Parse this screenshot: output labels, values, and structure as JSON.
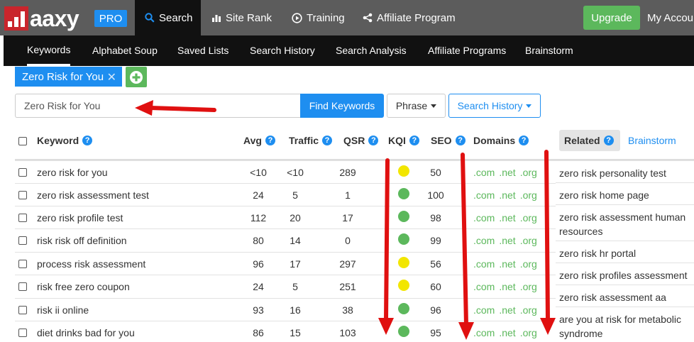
{
  "brand": {
    "logo_text": "aaxy",
    "badge": "PRO"
  },
  "topnav": [
    {
      "label": "Search",
      "icon": "search-icon",
      "active": true
    },
    {
      "label": "Site Rank",
      "icon": "bar-chart-icon"
    },
    {
      "label": "Training",
      "icon": "play-circle-icon"
    },
    {
      "label": "Affiliate Program",
      "icon": "share-icon"
    }
  ],
  "upgrade_label": "Upgrade",
  "account_label": "My Account",
  "subnav": [
    "Keywords",
    "Alphabet Soup",
    "Saved Lists",
    "Search History",
    "Search Analysis",
    "Affiliate Programs",
    "Brainstorm"
  ],
  "keyword_tab": "Zero Risk for You",
  "search": {
    "value": "Zero Risk for You",
    "find_label": "Find Keywords",
    "phrase_label": "Phrase",
    "history_label": "Search History"
  },
  "table": {
    "headers": {
      "keyword": "Keyword",
      "avg": "Avg",
      "traffic": "Traffic",
      "qsr": "QSR",
      "kqi": "KQI",
      "seo": "SEO",
      "domains": "Domains"
    },
    "rows": [
      {
        "keyword": "zero risk for you",
        "avg": "<10",
        "traffic": "<10",
        "qsr": "289",
        "kqi": "yellow",
        "seo": "50"
      },
      {
        "keyword": "zero risk assessment test",
        "avg": "24",
        "traffic": "5",
        "qsr": "1",
        "kqi": "green",
        "seo": "100"
      },
      {
        "keyword": "zero risk profile test",
        "avg": "112",
        "traffic": "20",
        "qsr": "17",
        "kqi": "green",
        "seo": "98"
      },
      {
        "keyword": "risk risk off definition",
        "avg": "80",
        "traffic": "14",
        "qsr": "0",
        "kqi": "green",
        "seo": "99"
      },
      {
        "keyword": "process risk assessment",
        "avg": "96",
        "traffic": "17",
        "qsr": "297",
        "kqi": "yellow",
        "seo": "56"
      },
      {
        "keyword": "risk free zero coupon",
        "avg": "24",
        "traffic": "5",
        "qsr": "251",
        "kqi": "yellow",
        "seo": "60"
      },
      {
        "keyword": "risk ii online",
        "avg": "93",
        "traffic": "16",
        "qsr": "38",
        "kqi": "green",
        "seo": "96"
      },
      {
        "keyword": "diet drinks bad for you",
        "avg": "86",
        "traffic": "15",
        "qsr": "103",
        "kqi": "green",
        "seo": "95"
      }
    ],
    "domains": [
      ".com",
      ".net",
      ".org"
    ]
  },
  "related": {
    "tab_label": "Related",
    "brainstorm_label": "Brainstorm",
    "items": [
      "zero risk personality test",
      "zero risk home page",
      "zero risk assessment human resources",
      "zero risk hr portal",
      "zero risk profiles assessment",
      "zero risk assessment aa",
      "are you at risk for metabolic syndrome"
    ]
  },
  "colors": {
    "accent": "#1e8ef0",
    "green": "#5cb85c",
    "yellow": "#f2e600",
    "kqi_green": "#5cb85c",
    "arrow": "#e01010",
    "logo_red": "#c9252c"
  }
}
